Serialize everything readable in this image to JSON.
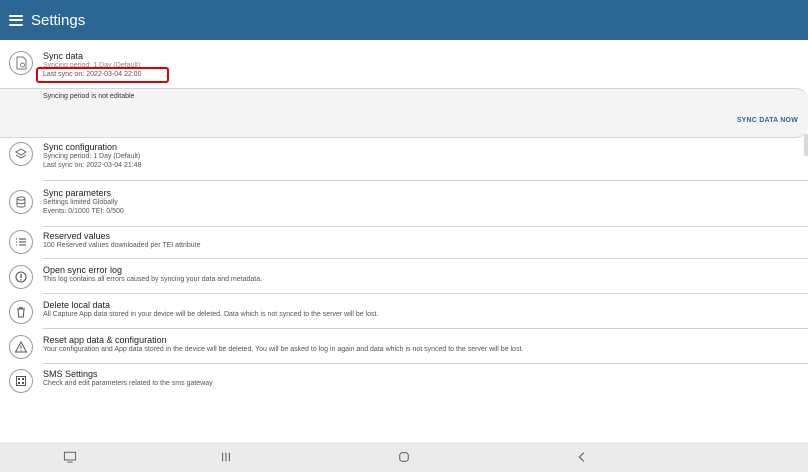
{
  "header": {
    "title": "Settings",
    "menu_icon": "hamburger-menu-icon"
  },
  "sync_data": {
    "title": "Sync data",
    "subtitle": "Syncing period: 1 Day (Default)",
    "last_sync": "Last sync on: 2022-03-04 22:00",
    "message": "Syncing period is not editable",
    "action": "SYNC DATA NOW"
  },
  "items": [
    {
      "title": "Sync configuration",
      "lines": [
        "Syncing period: 1 Day (Default)",
        "Last sync on: 2022-03-04 21:48"
      ]
    },
    {
      "title": "Sync parameters",
      "lines": [
        "Settings limited Globally",
        "Events: 0/1000 TEI: 0/500"
      ]
    },
    {
      "title": "Reserved values",
      "lines": [
        "100 Reserved values downloaded per TEI attribute"
      ]
    },
    {
      "title": "Open sync error log",
      "lines": [
        "This log contains all errors caused by syncing your data and metadata."
      ]
    },
    {
      "title": "Delete local data",
      "lines": [
        "All Capture App data stored in your device will be deleted. Data which is not synced to the server will be lost."
      ]
    },
    {
      "title": "Reset app data & configuration",
      "lines": [
        "Your configuration and App data stored in the device will be deleted. You will be asked to log in again and data which is not synced to the server will be lost."
      ]
    },
    {
      "title": "SMS Settings",
      "lines": [
        "Check and edit parameters related to the sms gateway"
      ]
    }
  ],
  "navbar": {
    "icons": [
      "screenshot-icon",
      "recent-apps-icon",
      "home-icon",
      "back-icon"
    ]
  },
  "colors": {
    "appbar": "#2c6693",
    "accent": "#2c6693",
    "highlight": "#e00000"
  }
}
